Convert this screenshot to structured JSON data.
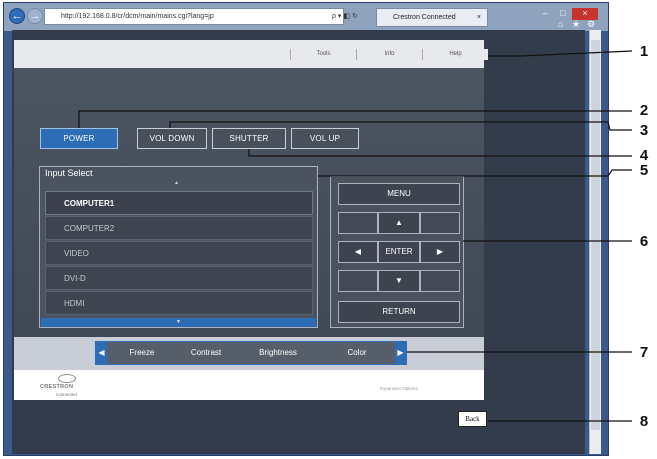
{
  "browser": {
    "address_url": "http://192.168.0.8/cr/dcm/main/mains.cgi?lang=jp",
    "address_tools": "ρ ▾ ◧ ↻",
    "tab_title": "Crestron Connected",
    "tab_close": "×",
    "back_glyph": "←",
    "forward_glyph": "→",
    "min_glyph": "–",
    "max_glyph": "□",
    "close_glyph": "×",
    "home_glyph": "⌂",
    "favorites_glyph": "★",
    "settings_glyph": "⚙"
  },
  "top_tabs": [
    "Tools",
    "Info",
    "Help"
  ],
  "controls": {
    "power": "POWER",
    "vol_down": "VOL DOWN",
    "shutter": "SHUTTER",
    "vol_up": "VOL UP"
  },
  "input_select": {
    "title": "Input Select",
    "scroll_up": "▲",
    "scroll_down": "▼",
    "items": [
      "COMPUTER1",
      "COMPUTER2",
      "VIDEO",
      "DVI-D",
      "HDMI"
    ],
    "selected": "COMPUTER1"
  },
  "cursor_pad": {
    "menu": "MENU",
    "up": "▲",
    "left": "◀",
    "enter": "ENTER",
    "right": "▶",
    "down": "▼",
    "return": "RETURN"
  },
  "toolbar": {
    "items": [
      "Freeze",
      "Contrast",
      "Brightness",
      "Color"
    ],
    "left_arrow": "◀",
    "right_arrow": "▶"
  },
  "footer": {
    "logo_word": "CRESTRON",
    "logo_sub": "connected",
    "right_text": "Expansion Options"
  },
  "back_label": "Back",
  "callouts": [
    "1",
    "2",
    "3",
    "4",
    "5",
    "6",
    "7",
    "8"
  ],
  "colors": {
    "accent_blue": "#2d6db5",
    "page_bg": "#323c4a",
    "close_red": "#c7332d"
  }
}
